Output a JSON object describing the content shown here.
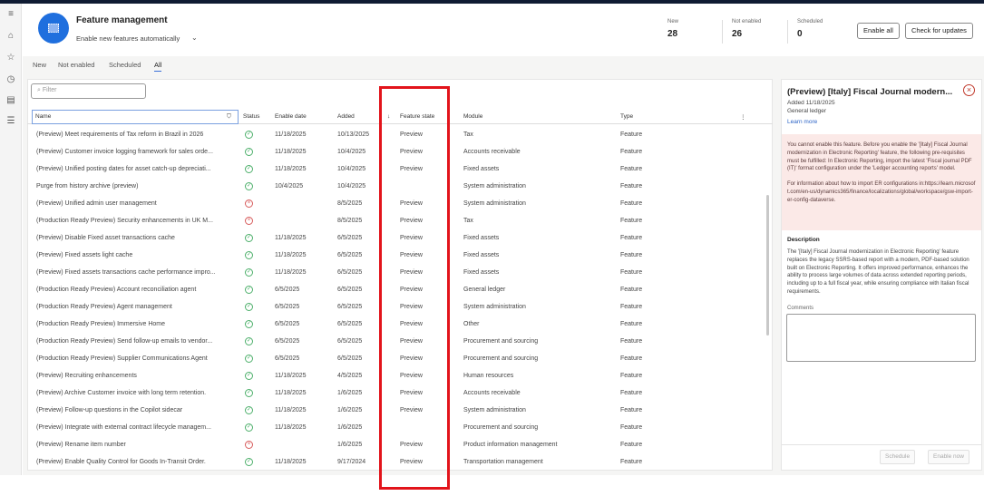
{
  "header": {
    "title": "Feature management",
    "auto_enable": "Enable new features automatically",
    "stats": [
      {
        "label": "New",
        "value": "28"
      },
      {
        "label": "Not enabled",
        "value": "26"
      },
      {
        "label": "Scheduled",
        "value": "0"
      }
    ],
    "enable_all": "Enable all",
    "check_updates": "Check for updates"
  },
  "tabs": [
    "New",
    "Not enabled",
    "Scheduled",
    "All"
  ],
  "grid": {
    "filter_placeholder": "Filter",
    "columns": [
      "Name",
      "Status",
      "Enable date",
      "Added",
      "Feature state",
      "Module",
      "Type"
    ],
    "rows": [
      {
        "name": "(Preview) Meet requirements of Tax reform in Brazil in 2026",
        "status": "enabled",
        "enable_date": "11/18/2025",
        "added": "10/13/2025",
        "state": "Preview",
        "module": "Tax",
        "type": "Feature"
      },
      {
        "name": "(Preview) Customer invoice logging framework for sales orde...",
        "status": "enabled",
        "enable_date": "11/18/2025",
        "added": "10/4/2025",
        "state": "Preview",
        "module": "Accounts receivable",
        "type": "Feature"
      },
      {
        "name": "(Preview) Unified posting dates for asset catch-up depreciati...",
        "status": "enabled",
        "enable_date": "11/18/2025",
        "added": "10/4/2025",
        "state": "Preview",
        "module": "Fixed assets",
        "type": "Feature"
      },
      {
        "name": "Purge from history archive (preview)",
        "status": "enabled",
        "enable_date": "10/4/2025",
        "added": "10/4/2025",
        "state": "",
        "module": "System administration",
        "type": "Feature"
      },
      {
        "name": "(Preview) Unified admin user management",
        "status": "not-enabled",
        "enable_date": "",
        "added": "8/5/2025",
        "state": "Preview",
        "module": "System administration",
        "type": "Feature"
      },
      {
        "name": "(Production Ready Preview) Security enhancements in UK M...",
        "status": "not-enabled",
        "enable_date": "",
        "added": "8/5/2025",
        "state": "Preview",
        "module": "Tax",
        "type": "Feature"
      },
      {
        "name": "(Preview) Disable Fixed asset transactions cache",
        "status": "enabled",
        "enable_date": "11/18/2025",
        "added": "6/5/2025",
        "state": "Preview",
        "module": "Fixed assets",
        "type": "Feature"
      },
      {
        "name": "(Preview) Fixed assets light cache",
        "status": "enabled",
        "enable_date": "11/18/2025",
        "added": "6/5/2025",
        "state": "Preview",
        "module": "Fixed assets",
        "type": "Feature"
      },
      {
        "name": "(Preview) Fixed assets transactions cache performance impro...",
        "status": "enabled",
        "enable_date": "11/18/2025",
        "added": "6/5/2025",
        "state": "Preview",
        "module": "Fixed assets",
        "type": "Feature"
      },
      {
        "name": "(Production Ready Preview) Account reconciliation agent",
        "status": "enabled",
        "enable_date": "6/5/2025",
        "added": "6/5/2025",
        "state": "Preview",
        "module": "General ledger",
        "type": "Feature"
      },
      {
        "name": "(Production Ready Preview) Agent management",
        "status": "enabled",
        "enable_date": "6/5/2025",
        "added": "6/5/2025",
        "state": "Preview",
        "module": "System administration",
        "type": "Feature"
      },
      {
        "name": "(Production Ready Preview) Immersive Home",
        "status": "enabled",
        "enable_date": "6/5/2025",
        "added": "6/5/2025",
        "state": "Preview",
        "module": "Other",
        "type": "Feature"
      },
      {
        "name": "(Production Ready Preview) Send follow-up emails to vendor...",
        "status": "enabled",
        "enable_date": "6/5/2025",
        "added": "6/5/2025",
        "state": "Preview",
        "module": "Procurement and sourcing",
        "type": "Feature"
      },
      {
        "name": "(Production Ready Preview) Supplier Communications Agent",
        "status": "enabled",
        "enable_date": "6/5/2025",
        "added": "6/5/2025",
        "state": "Preview",
        "module": "Procurement and sourcing",
        "type": "Feature"
      },
      {
        "name": "(Preview) Recruiting enhancements",
        "status": "enabled",
        "enable_date": "11/18/2025",
        "added": "4/5/2025",
        "state": "Preview",
        "module": "Human resources",
        "type": "Feature"
      },
      {
        "name": "(Preview) Archive Customer invoice with long term retention.",
        "status": "enabled",
        "enable_date": "11/18/2025",
        "added": "1/6/2025",
        "state": "Preview",
        "module": "Accounts receivable",
        "type": "Feature"
      },
      {
        "name": "(Preview) Follow-up questions in the Copilot sidecar",
        "status": "enabled",
        "enable_date": "11/18/2025",
        "added": "1/6/2025",
        "state": "Preview",
        "module": "System administration",
        "type": "Feature"
      },
      {
        "name": "(Preview) Integrate with external contract lifecycle managem...",
        "status": "enabled",
        "enable_date": "11/18/2025",
        "added": "1/6/2025",
        "state": "",
        "module": "Procurement and sourcing",
        "type": "Feature"
      },
      {
        "name": "(Preview) Rename item number",
        "status": "not-enabled",
        "enable_date": "",
        "added": "1/6/2025",
        "state": "Preview",
        "module": "Product information management",
        "type": "Feature"
      },
      {
        "name": "(Preview) Enable Quality Control for Goods In-Transit Order.",
        "status": "enabled",
        "enable_date": "11/18/2025",
        "added": "9/17/2024",
        "state": "Preview",
        "module": "Transportation management",
        "type": "Feature"
      }
    ]
  },
  "panel": {
    "title": "(Preview) [Italy] Fiscal Journal modern...",
    "added": "Added 11/18/2025",
    "module": "General ledger",
    "learn_more": "Learn more",
    "warning": "You cannot enable this feature. Before you enable the '[Italy] Fiscal Journal modernization in Electronic Reporting' feature, the following pre-requisites must be fulfilled: In Electronic Reporting, import the latest 'Fiscal journal PDF (IT)' format configuration under the 'Ledger accounting reports' model.",
    "warning2": "For information about how to import ER configurations in:https://learn.microsoft.com/en-us/dynamics365/finance/localizations/global/workspace/gsw-import-er-config-dataverse.",
    "description_heading": "Description",
    "description": "The '[Italy] Fiscal Journal modernization in Electronic Reporting' feature replaces the legacy SSRS-based report with a modern, PDF-based solution built on Electronic Reporting. It offers improved performance, enhances the ability to process large volumes of data across extended reporting periods, including up to a full fiscal year, while ensuring compliance with Italian fiscal requirements.",
    "comments_label": "Comments",
    "schedule": "Schedule",
    "enable_now": "Enable now"
  },
  "colors": {
    "accent": "#1f6fde",
    "highlight": "#e2141b",
    "warning_bg": "#fbe9e7"
  }
}
